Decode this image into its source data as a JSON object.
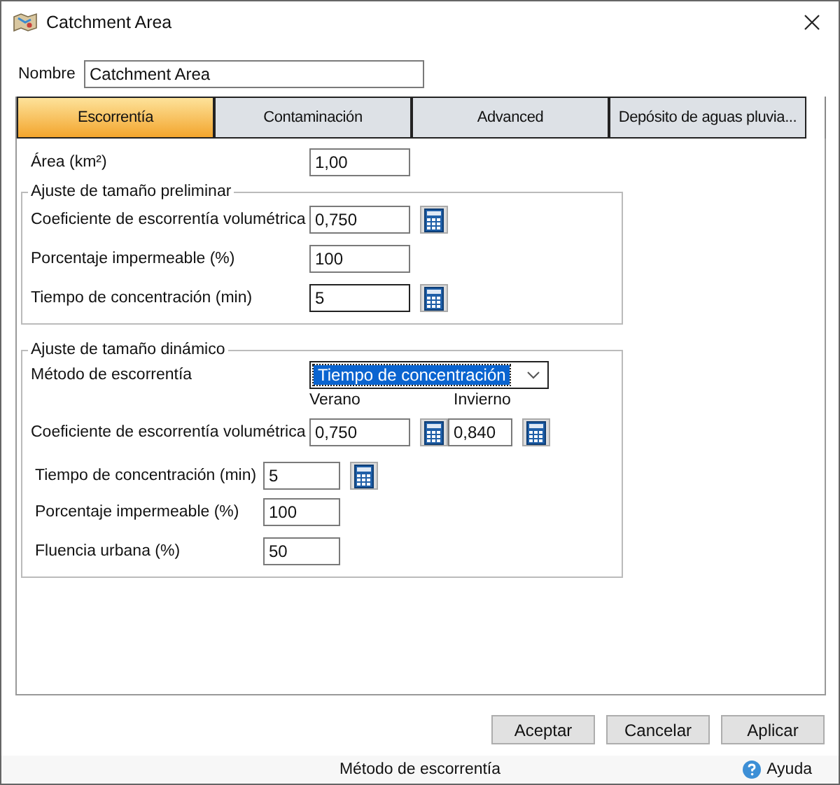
{
  "window": {
    "title": "Catchment Area"
  },
  "name_field": {
    "label": "Nombre",
    "value": "Catchment Area"
  },
  "tabs": [
    {
      "label": "Escorrentía",
      "selected": true
    },
    {
      "label": "Contaminación",
      "selected": false
    },
    {
      "label": "Advanced",
      "selected": false
    },
    {
      "label": "Depósito de aguas pluvia...",
      "selected": false
    }
  ],
  "area": {
    "label": "Área (km²)",
    "value": "1,00"
  },
  "preliminary": {
    "title": "Ajuste de tamaño preliminar",
    "rows": [
      {
        "label": "Coeficiente de escorrentía volumétrica",
        "value": "0,750",
        "calculator": true,
        "focused": false
      },
      {
        "label": "Porcentaje impermeable (%)",
        "value": "100",
        "calculator": false,
        "focused": false
      },
      {
        "label": "Tiempo de concentración (min)",
        "value": "5",
        "calculator": true,
        "focused": true
      }
    ]
  },
  "dynamic": {
    "title": "Ajuste de tamaño dinámico",
    "method": {
      "label": "Método de escorrentía",
      "value": "Tiempo de concentración"
    },
    "season_headers": [
      "Verano",
      "Invierno"
    ],
    "coefficient": {
      "label": "Coeficiente de escorrentía volumétrica",
      "values": [
        "0,750",
        "0,840"
      ]
    },
    "rows": [
      {
        "label": "Tiempo de concentración (min)",
        "value": "5",
        "calculator": true
      },
      {
        "label": "Porcentaje impermeable (%)",
        "value": "100",
        "calculator": false
      },
      {
        "label": "Fluencia urbana (%)",
        "value": "50",
        "calculator": false
      }
    ]
  },
  "buttons": [
    "Aceptar",
    "Cancelar",
    "Aplicar"
  ],
  "status_bar": {
    "text": "Método de escorrentía",
    "help": "Ayuda"
  }
}
